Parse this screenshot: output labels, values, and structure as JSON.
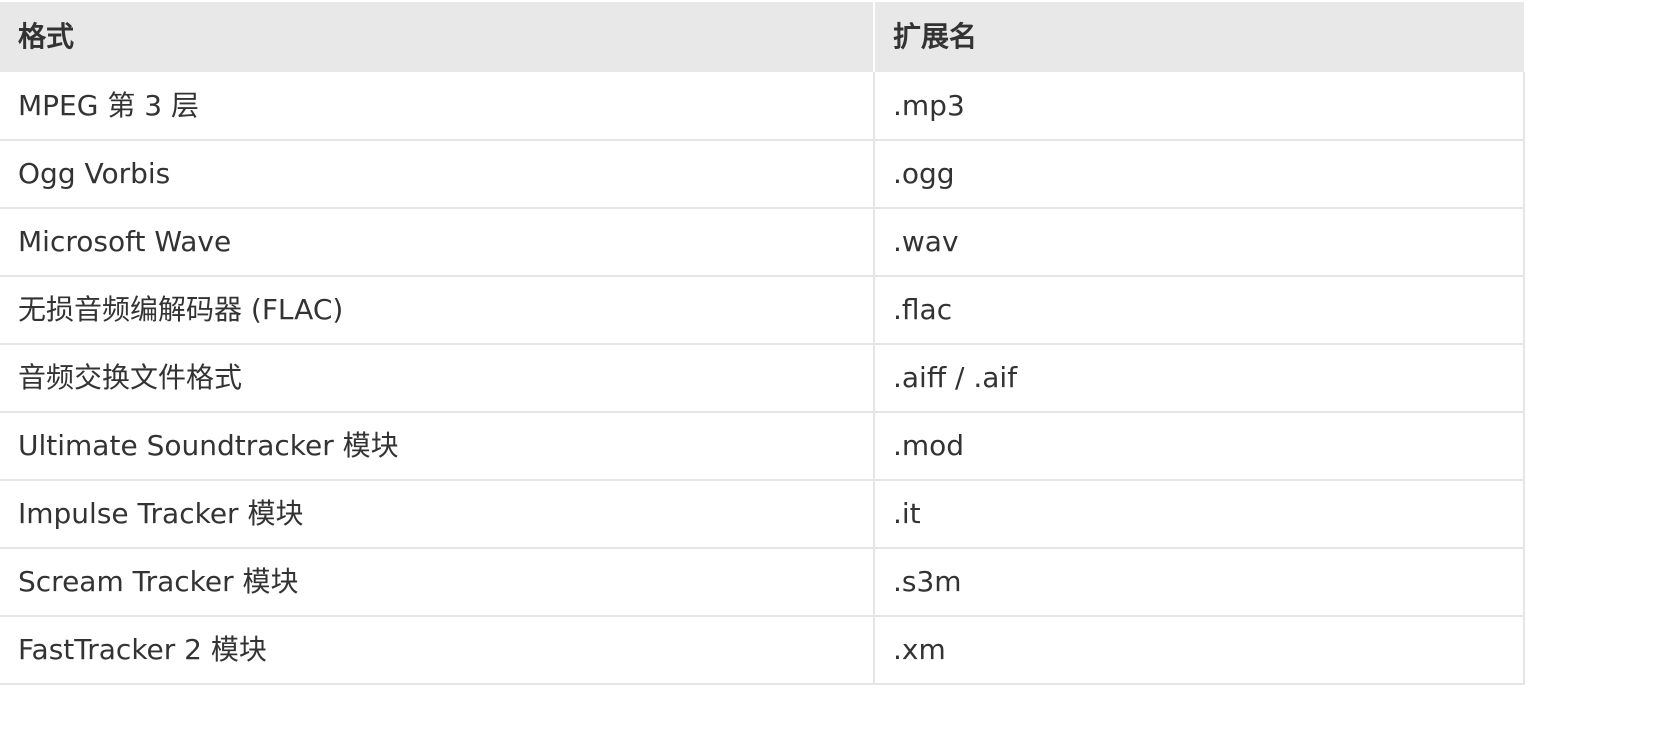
{
  "table": {
    "headers": [
      "格式",
      "扩展名"
    ],
    "rows": [
      {
        "format": "MPEG 第 3 层",
        "extension": ".mp3"
      },
      {
        "format": "Ogg Vorbis",
        "extension": ".ogg"
      },
      {
        "format": "Microsoft Wave",
        "extension": ".wav"
      },
      {
        "format": "无损音频编解码器 (FLAC)",
        "extension": ".flac"
      },
      {
        "format": "音频交换文件格式",
        "extension": ".aiff / .aif"
      },
      {
        "format": "Ultimate Soundtracker 模块",
        "extension": ".mod"
      },
      {
        "format": "Impulse Tracker 模块",
        "extension": ".it"
      },
      {
        "format": "Scream Tracker 模块",
        "extension": ".s3m"
      },
      {
        "format": "FastTracker 2 模块",
        "extension": ".xm"
      }
    ]
  },
  "colors": {
    "header_background": "#e8e8e8",
    "border": "#e5e5e5",
    "text": "#333333"
  }
}
